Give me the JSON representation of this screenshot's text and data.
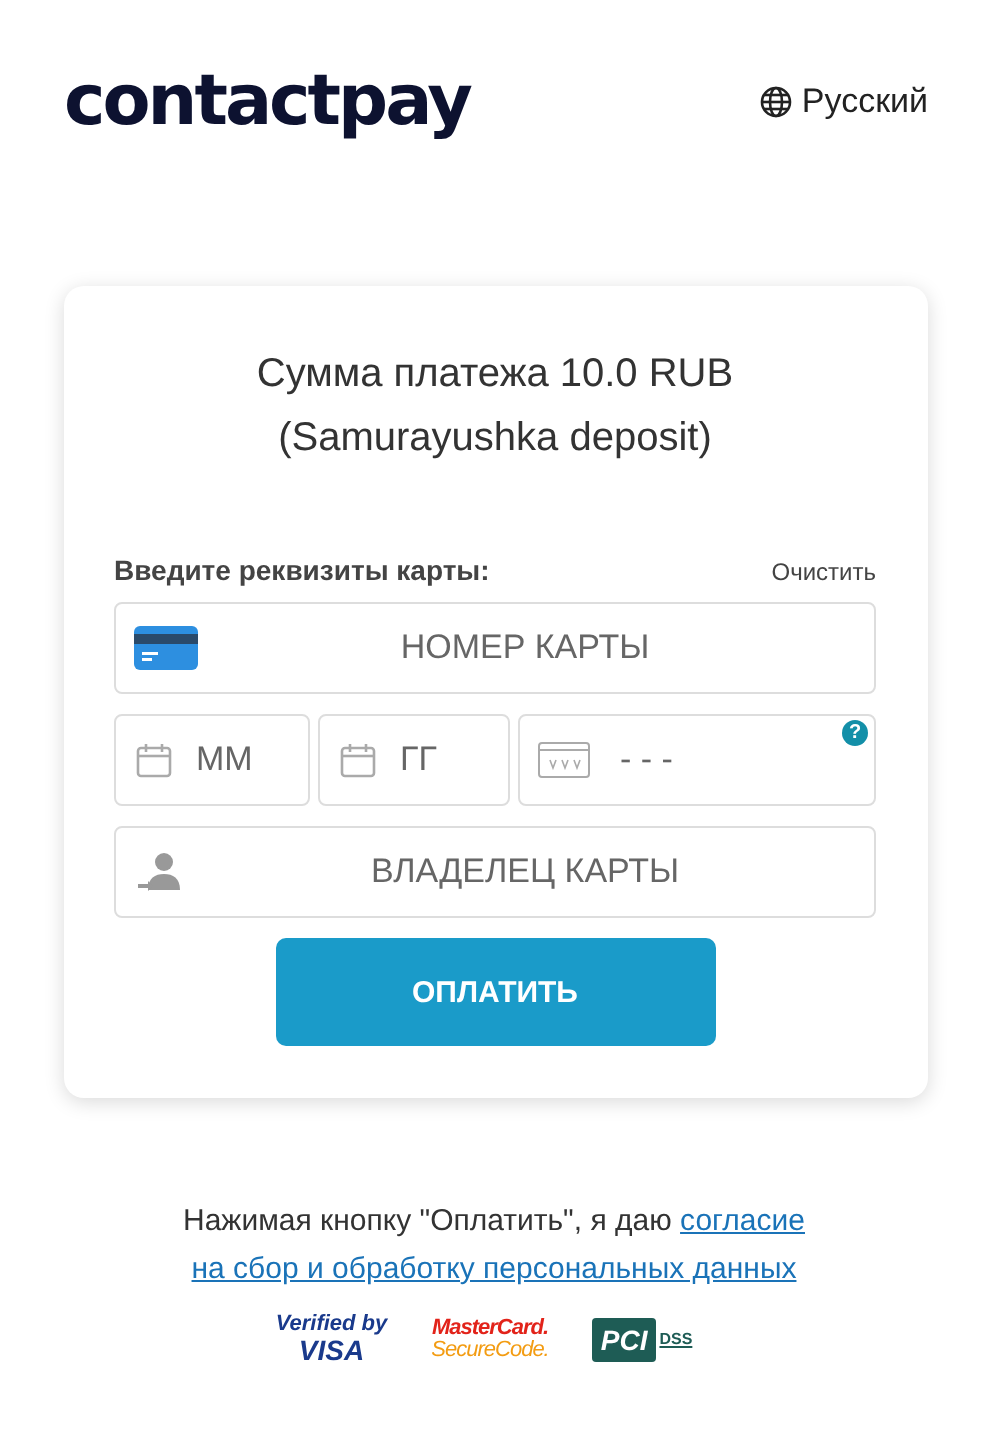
{
  "header": {
    "logo": "contactpay",
    "language": "Русский"
  },
  "payment": {
    "title_lines": [
      "Сумма платежа 10.0 RUB",
      "(Samurayushka deposit)"
    ],
    "form_label": "Введите реквизиты карты:",
    "clear": "Очистить",
    "fields": [
      {
        "kind": "card",
        "placeholder": "НОМЕР КАРТЫ"
      },
      {
        "kind": "month",
        "placeholder": "ММ"
      },
      {
        "kind": "year",
        "placeholder": "ГГ"
      },
      {
        "kind": "cvv",
        "placeholder": "- - -",
        "help": "?"
      },
      {
        "kind": "holder",
        "placeholder": "ВЛАДЕЛЕЦ КАРТЫ"
      }
    ],
    "pay_button": "ОПЛАТИТЬ"
  },
  "consent": {
    "text": "Нажимая кнопку \"Оплатить\", я даю",
    "link_parts": [
      "согласие",
      "на сбор и обработку персональных данных"
    ]
  },
  "badges": [
    {
      "kind": "visa",
      "lines": [
        "Verified by",
        "VISA"
      ]
    },
    {
      "kind": "mastercard",
      "lines": [
        "MasterCard.",
        "SecureCode."
      ]
    },
    {
      "kind": "pci",
      "lines": [
        "PCI",
        "DSS"
      ]
    }
  ]
}
